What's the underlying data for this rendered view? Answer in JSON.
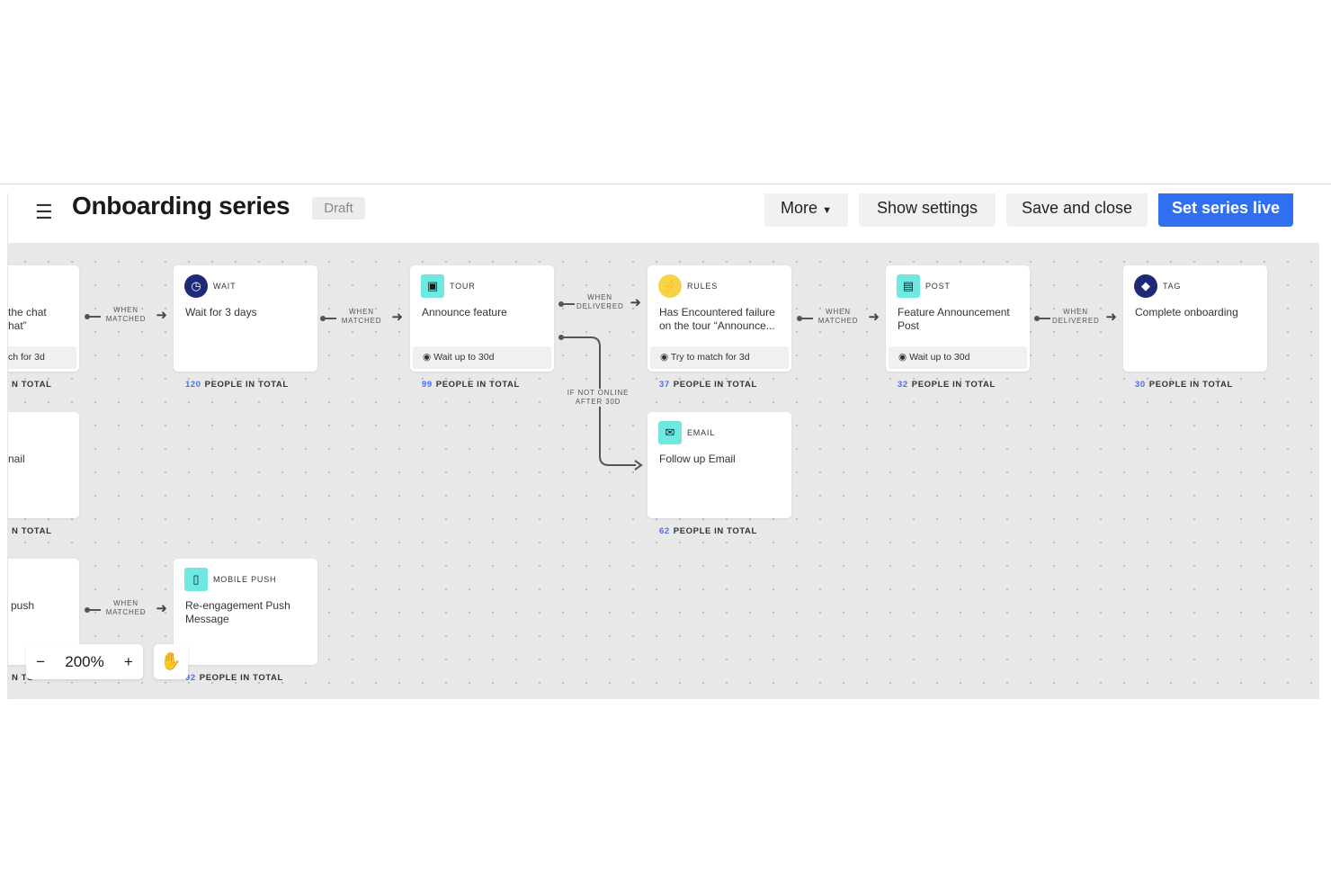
{
  "header": {
    "title": "Onboarding series",
    "status_badge": "Draft",
    "buttons": {
      "more": "More",
      "show_settings": "Show settings",
      "save_close": "Save and close",
      "set_live": "Set series live"
    },
    "accent": "#2f6ff0"
  },
  "nodes": [
    {
      "id": "partial-1",
      "partial": true,
      "body": "the chat\nhat”",
      "footer": "ch for 3d",
      "total_count": "",
      "total_label": "N TOTAL"
    },
    {
      "id": "wait",
      "type": "WAIT",
      "icon": "clock-icon",
      "icon_color": "#1e2a78",
      "body": "Wait for 3 days",
      "footer": "",
      "total_count": "120",
      "total_label": "PEOPLE IN TOTAL"
    },
    {
      "id": "tour",
      "type": "TOUR",
      "icon": "tour-icon",
      "icon_color": "#6ee8e0",
      "body": "Announce feature",
      "footer": "Wait up to 30d",
      "total_count": "99",
      "total_label": "PEOPLE IN TOTAL"
    },
    {
      "id": "rules",
      "type": "RULES",
      "icon": "lightning-icon",
      "icon_color": "#f5d547",
      "body": "Has Encountered failure on the tour “Announce...",
      "footer": "Try to match for 3d",
      "total_count": "37",
      "total_label": "PEOPLE IN TOTAL"
    },
    {
      "id": "post",
      "type": "POST",
      "icon": "post-icon",
      "icon_color": "#6ee8e0",
      "body": "Feature Announcement Post",
      "footer": "Wait up to 30d",
      "total_count": "32",
      "total_label": "PEOPLE IN TOTAL"
    },
    {
      "id": "tag",
      "type": "TAG",
      "icon": "tag-icon",
      "icon_color": "#1e2a78",
      "body": "Complete onboarding",
      "footer": "",
      "total_count": "30",
      "total_label": "PEOPLE IN TOTAL"
    },
    {
      "id": "partial-2",
      "partial": true,
      "body": "nail",
      "footer": "",
      "total_count": "",
      "total_label": "N TOTAL"
    },
    {
      "id": "email",
      "type": "EMAIL",
      "icon": "email-icon",
      "icon_color": "#6ee8e0",
      "body": "Follow up Email",
      "footer": "",
      "total_count": "62",
      "total_label": "PEOPLE IN TOTAL"
    },
    {
      "id": "partial-3",
      "partial": true,
      "body": "push",
      "footer": "",
      "total_count": "",
      "total_label": "N TO"
    },
    {
      "id": "mobile-push",
      "type": "MOBILE PUSH",
      "icon": "mobile-icon",
      "icon_color": "#6ee8e0",
      "body": "Re-engagement Push Message",
      "footer": "",
      "total_count": "92",
      "total_label": "PEOPLE IN TOTAL"
    }
  ],
  "connectors": [
    {
      "label": "WHEN MATCHED"
    },
    {
      "label": "WHEN MATCHED"
    },
    {
      "label": "WHEN DELIVERED"
    },
    {
      "label": "WHEN MATCHED"
    },
    {
      "label": "WHEN DELIVERED"
    },
    {
      "label": "WHEN MATCHED"
    }
  ],
  "branch": {
    "label": "IF NOT ONLINE AFTER 30D"
  },
  "zoom": {
    "minus": "−",
    "level": "200%",
    "plus": "+"
  }
}
